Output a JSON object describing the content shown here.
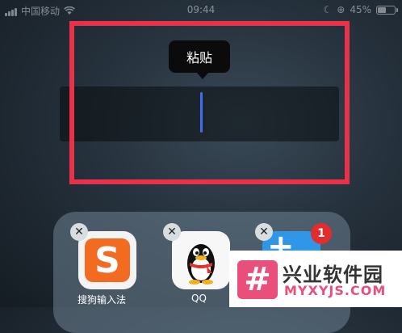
{
  "status_bar": {
    "carrier": "中国移动",
    "time": "09:44",
    "battery_percent": "45%",
    "battery_level": 0.45
  },
  "context_menu": {
    "paste_label": "粘贴"
  },
  "folder": {
    "apps": [
      {
        "label": "搜狗输入法",
        "icon": "sogou-icon",
        "color": "#f36b21"
      },
      {
        "label": "QQ",
        "icon": "qq-penguin-icon",
        "color": "#f7f7f7"
      },
      {
        "label": "",
        "icon": "app-icon",
        "color": "#2f96e8",
        "badge": "1"
      }
    ],
    "delete_symbol": "✕"
  },
  "highlight_color": "#e9314a",
  "watermark": {
    "title": "兴业软件园",
    "url": "MYXYJS.COM"
  }
}
